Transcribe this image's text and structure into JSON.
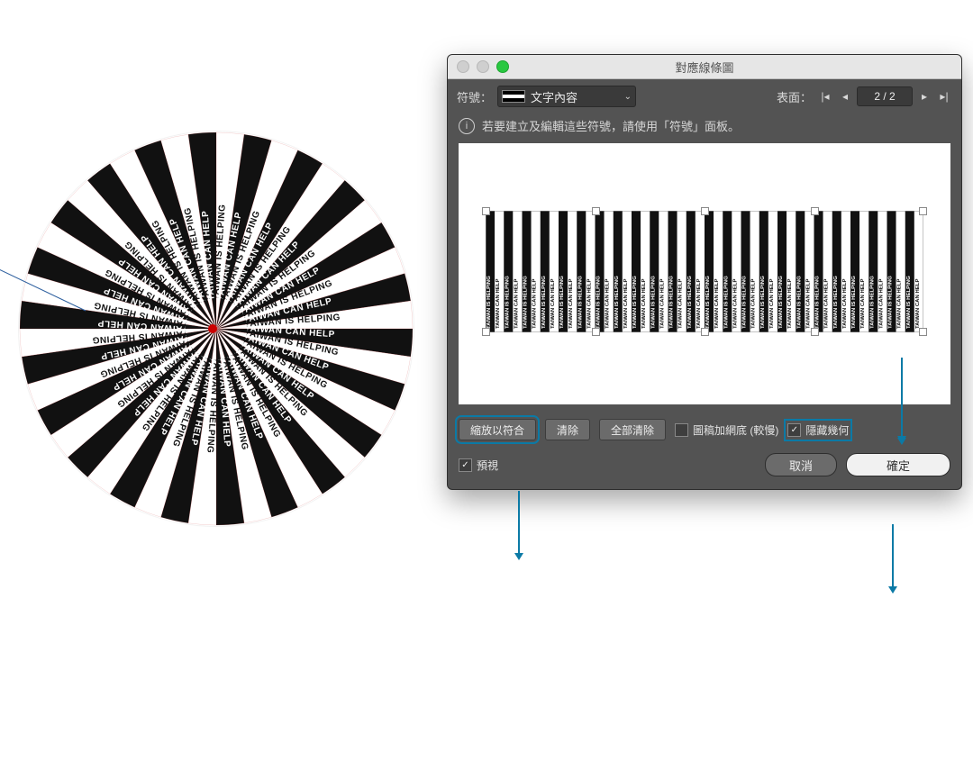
{
  "art_text_a": "TAIWAN IS HELPING",
  "art_text_b": "TAIWAN CAN HELP",
  "dialog": {
    "title": "對應線條圖",
    "symbol_label": "符號：",
    "symbol_selected": "文字內容",
    "surface_label": "表面：",
    "page": "2 / 2",
    "note": "若要建立及編輯這些符號，請使用「符號」面板。",
    "buttons": {
      "fit": "縮放以符合",
      "clear": "清除",
      "clear_all": "全部清除"
    },
    "check_shade": "圖稿加網底 (較慢)",
    "check_hide_geom": "隱藏幾何",
    "preview": "預視",
    "cancel": "取消",
    "ok": "確定"
  }
}
